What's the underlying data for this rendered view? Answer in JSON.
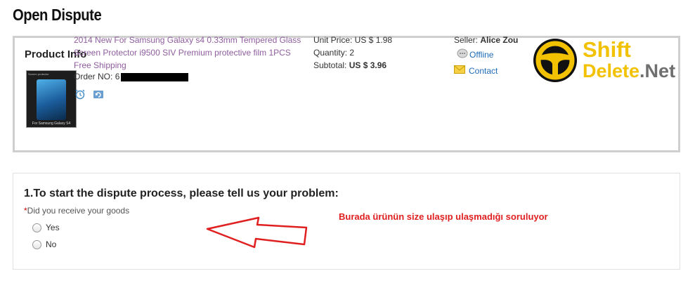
{
  "page": {
    "title": "Open Dispute"
  },
  "product_info": {
    "heading": "Product Info",
    "product_link": "2014 New For Samsung Galaxy s4 0.33mm Tempered Glass Screen Protector i9500 SIV Premium protective film 1PCS Free Shipping",
    "order_no_label": "Order NO: ",
    "order_no_prefix": "6",
    "thumbnail_caption": "For Samsung Galaxy S4",
    "thumbnail_top": "Screen protector",
    "unit_price": "Unit Price: US $ 1.98",
    "quantity": "Quantity: 2",
    "subtotal_label": "Subtotal: ",
    "subtotal_value": "US $ 3.96",
    "seller_label": "Seller: ",
    "seller_name": "Alice Zou",
    "status": "Offline",
    "contact": "Contact",
    "icons": [
      "alarm-clock-icon",
      "refresh-icon",
      "chat-status-icon",
      "envelope-icon"
    ]
  },
  "watermark": {
    "word1": "Shift",
    "word2": "Delete",
    "word3": ".Net"
  },
  "dispute": {
    "question": "1.To start the dispute process, please tell us your problem:",
    "required_mark": "*",
    "sub_question": "Did you receive your goods",
    "options": [
      "Yes",
      "No"
    ]
  },
  "annotation": {
    "text": "Burada ürünün size ulaşıp ulaşmadığı soruluyor"
  },
  "colors": {
    "link": "#8f5d9e",
    "blue_link": "#1e6bb8",
    "annotation": "#e02020",
    "watermark_yellow": "#f2c200"
  }
}
